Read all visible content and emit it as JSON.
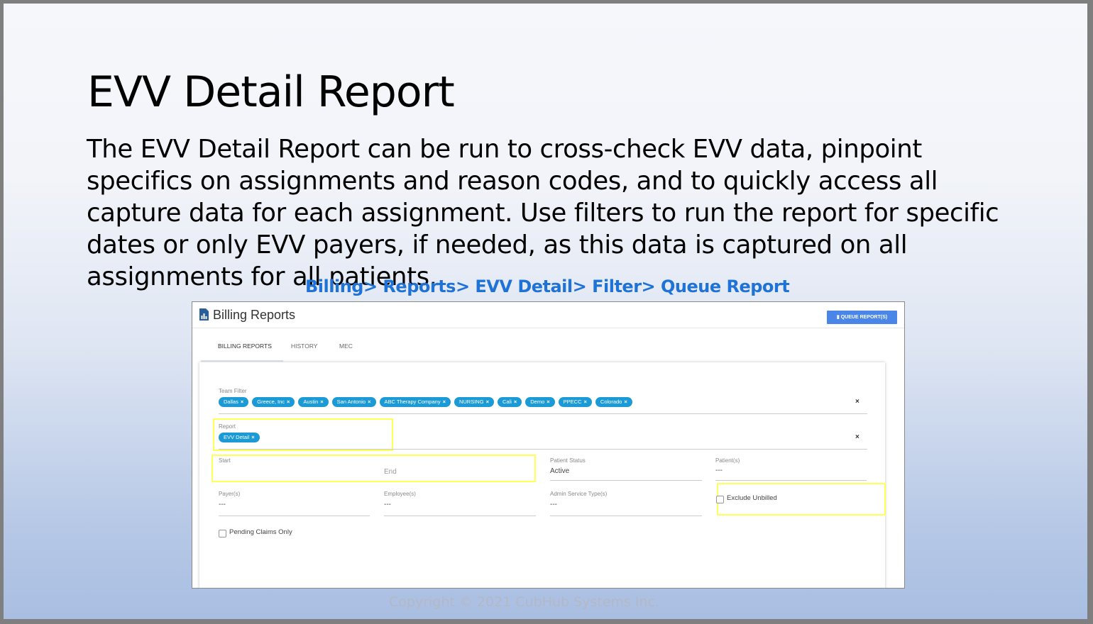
{
  "slide": {
    "title": "EVV Detail Report",
    "body": "The EVV Detail Report can be run to cross-check EVV data, pinpoint specifics on assignments and reason codes, and to quickly access all capture data for each assignment. Use filters to run the report for specific dates or only EVV payers, if needed, as this data is captured on all assignments for all patients.",
    "nav_path": "Billing> Reports> EVV Detail> Filter> Queue Report",
    "copyright": "Copyright © 2021 CubHub Systems Inc."
  },
  "app": {
    "title": "Billing Reports",
    "queue_button": "QUEUE REPORT(S)",
    "tabs": [
      "BILLING REPORTS",
      "HISTORY",
      "MEC"
    ]
  },
  "form": {
    "team_filter": {
      "label": "Team Filter",
      "chips": [
        "Dallas",
        "Greece, Inc",
        "Austin",
        "San Antonio",
        "ABC Therapy Company",
        "NURSING",
        "Cali",
        "Demo",
        "PPECC",
        "Colorado"
      ]
    },
    "report": {
      "label": "Report",
      "chip": "EVV Detail"
    },
    "start": {
      "label": "Start"
    },
    "end": {
      "placeholder": "End"
    },
    "patient_status": {
      "label": "Patient Status",
      "value": "Active"
    },
    "patients": {
      "label": "Patient(s)",
      "value": "---"
    },
    "payers": {
      "label": "Payer(s)",
      "value": "---"
    },
    "employees": {
      "label": "Employee(s)",
      "value": "---"
    },
    "admin_service_types": {
      "label": "Admin Service Type(s)",
      "value": "---"
    },
    "exclude_unbilled": {
      "label": "Exclude Unbilled",
      "checked": false
    },
    "pending_claims_only": {
      "label": "Pending Claims Only",
      "checked": false
    }
  },
  "colors": {
    "accent": "#1f73d6",
    "chip": "#1c9ad6",
    "button": "#4a86e8",
    "highlight": "#ffff5a"
  },
  "icons": {
    "app": "bar-chart-document-icon",
    "chip_remove": "close-icon"
  }
}
